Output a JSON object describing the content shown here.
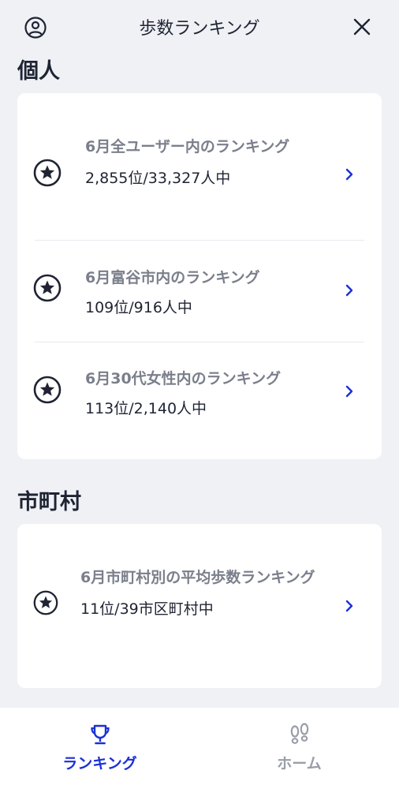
{
  "header": {
    "title": "歩数ランキング",
    "left_icon": "user-circle-icon",
    "right_icon": "close-icon"
  },
  "personal": {
    "section_title": "個人",
    "items": [
      {
        "label": "6月全ユーザー内のランキング",
        "value": "2,855位/33,327人中"
      },
      {
        "label": "6月富谷市内のランキング",
        "value": "109位/916人中"
      },
      {
        "label": "6月30代女性内のランキング",
        "value": "113位/2,140人中"
      }
    ]
  },
  "municipality": {
    "section_title": "市町村",
    "items": [
      {
        "label": "6月市町村別の平均歩数ランキング",
        "value": "11位/39市区町村中"
      }
    ]
  },
  "tabbar": {
    "tabs": [
      {
        "label": "ランキング",
        "icon": "trophy-icon",
        "active": true
      },
      {
        "label": "ホーム",
        "icon": "footprints-icon",
        "active": false
      }
    ]
  },
  "colors": {
    "background": "#eff1f5",
    "text_dark": "#1f2433",
    "text_muted": "#7a7f8b",
    "accent": "#1a31d4",
    "inactive": "#9a9ea8"
  }
}
